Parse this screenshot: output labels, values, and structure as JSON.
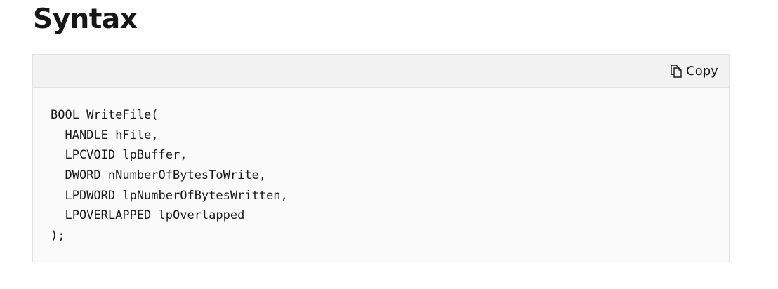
{
  "section": {
    "heading": "Syntax"
  },
  "code_block": {
    "copy_label": "Copy",
    "copy_icon": "copy-icon",
    "lines": [
      "BOOL WriteFile(",
      "  HANDLE hFile,",
      "  LPCVOID lpBuffer,",
      "  DWORD nNumberOfBytesToWrite,",
      "  LPDWORD lpNumberOfBytesWritten,",
      "  LPOVERLAPPED lpOverlapped",
      ");"
    ]
  },
  "colors": {
    "header_background": "#f2f2f2",
    "code_background": "#fafafa",
    "border": "#e3e3e3",
    "text": "#171717"
  }
}
